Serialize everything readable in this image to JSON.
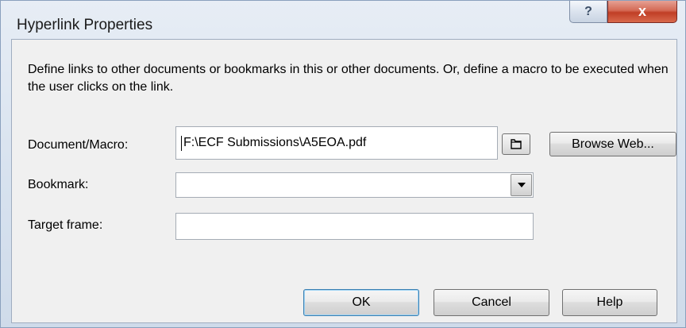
{
  "dialog": {
    "title": "Hyperlink Properties",
    "help_glyph": "?",
    "close_glyph": "x"
  },
  "description": "Define links to other documents or bookmarks in this or other documents. Or, define a macro to be executed when the user clicks on the link.",
  "fields": {
    "document_label": "Document/Macro:",
    "document_value": "F:\\ECF Submissions\\A5EOA.pdf",
    "bookmark_label": "Bookmark:",
    "bookmark_value": "",
    "target_label": "Target frame:",
    "target_value": ""
  },
  "buttons": {
    "browse_web": "Browse Web...",
    "ok": "OK",
    "cancel": "Cancel",
    "help": "Help"
  },
  "icons": {
    "browse_folder": "folder-icon",
    "dropdown": "chevron-down-icon"
  }
}
